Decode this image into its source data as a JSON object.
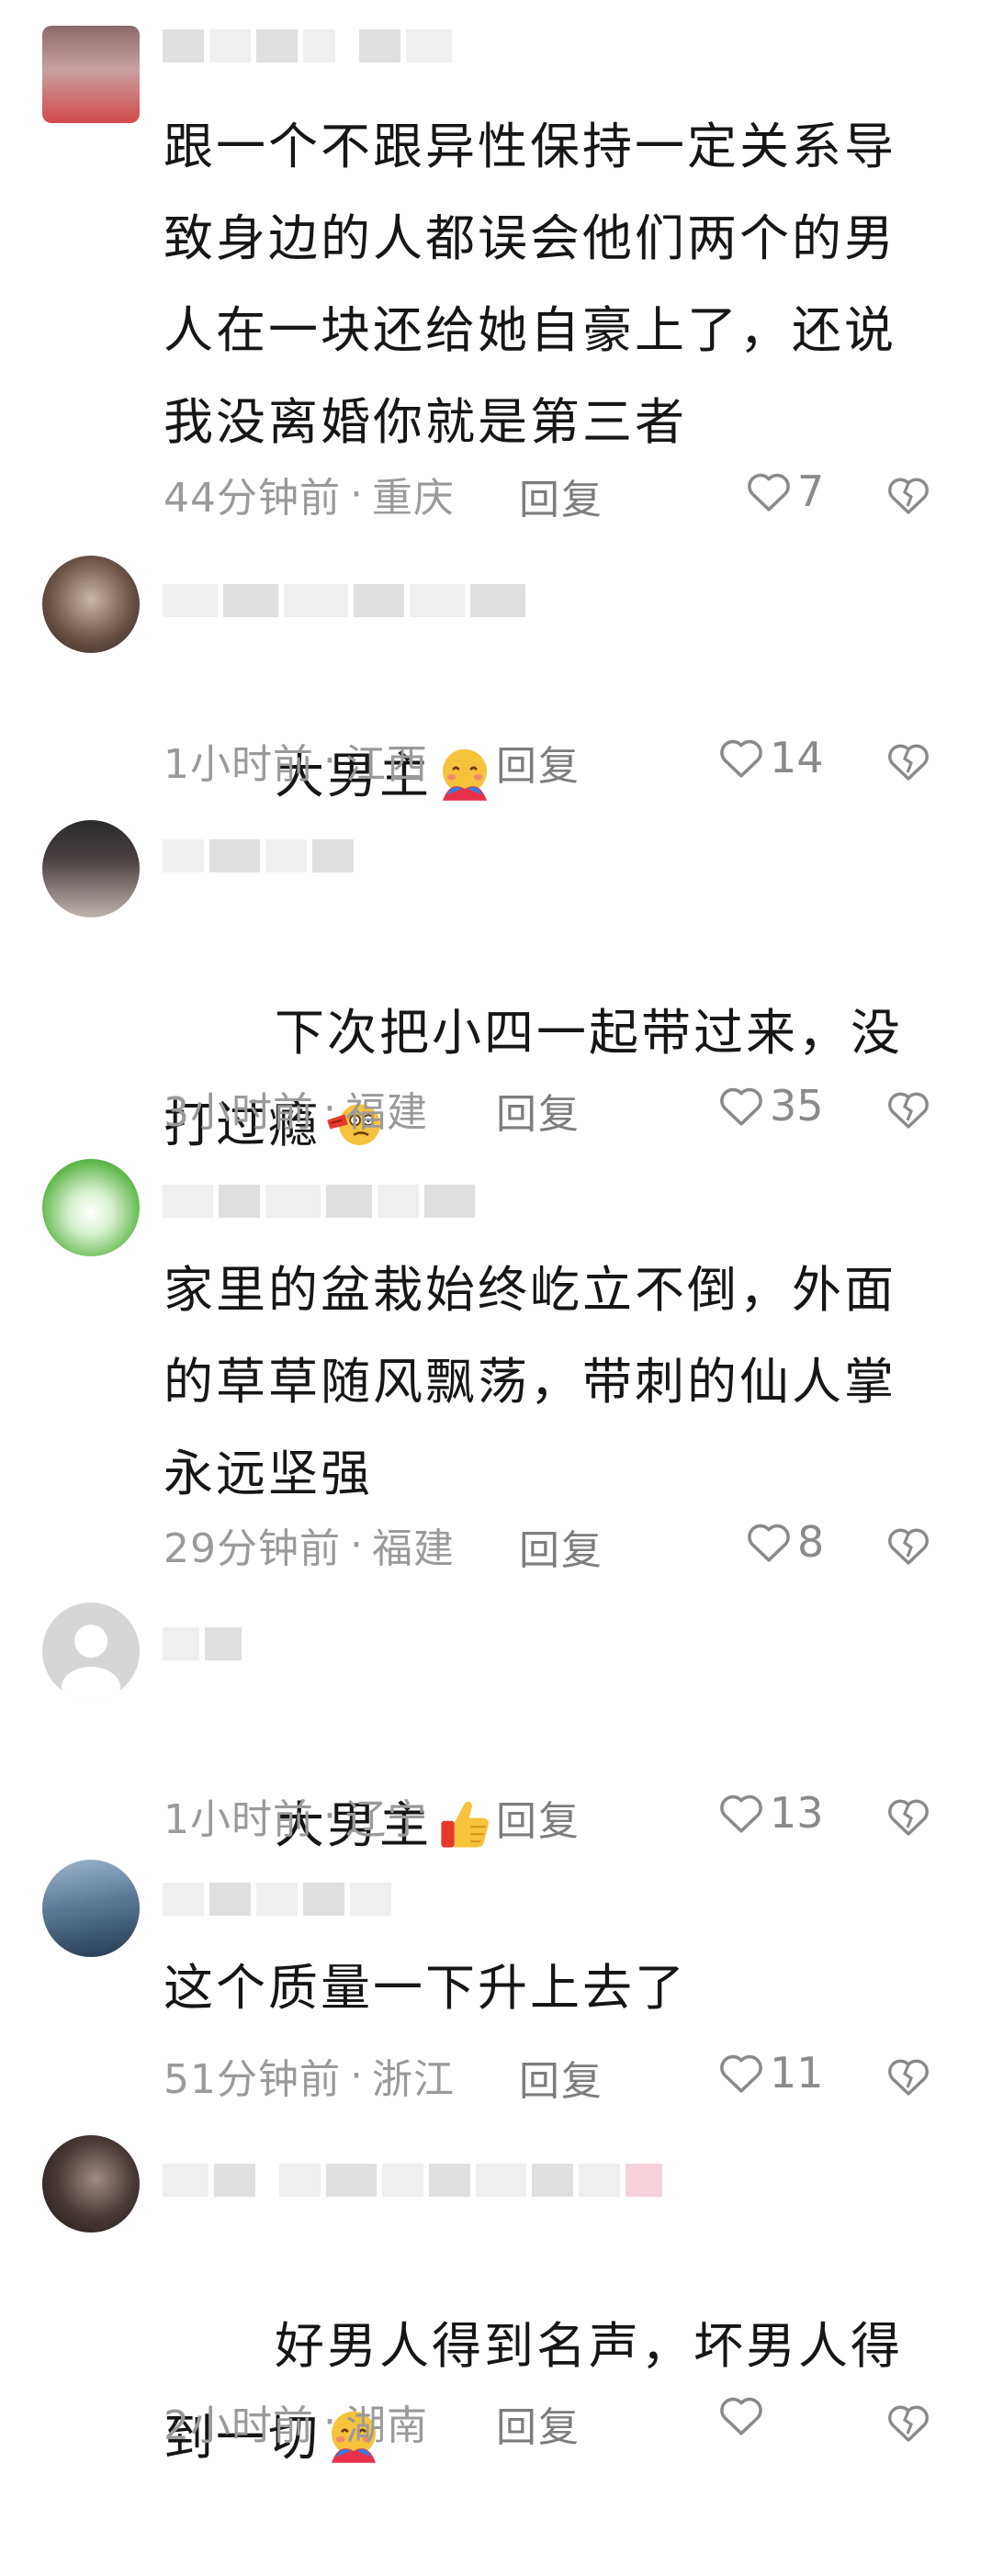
{
  "comments": [
    {
      "text": "跟一个不跟异性保持一定关系导致身边的人都误会他们两个的男人在一块还给她自豪上了，还说我没离婚你就是第三者",
      "time": "44分钟前",
      "location": "重庆",
      "reply_label": "回复",
      "likes": "7",
      "emoji": ""
    },
    {
      "text": "大男主",
      "time": "1小时前",
      "location": "江西",
      "reply_label": "回复",
      "likes": "14",
      "emoji": "hugging-face-emoji"
    },
    {
      "text": "下次把小四一起带过来，没打过瘾",
      "time": "3小时前",
      "location": "福建",
      "reply_label": "回复",
      "likes": "35",
      "emoji": "slap-face-emoji"
    },
    {
      "text": "家里的盆栽始终屹立不倒，外面的草草随风飘荡，带刺的仙人掌永远坚强",
      "time": "29分钟前",
      "location": "福建",
      "reply_label": "回复",
      "likes": "8",
      "emoji": ""
    },
    {
      "text": "大男主",
      "time": "1小时前",
      "location": "辽宁",
      "reply_label": "回复",
      "likes": "13",
      "emoji": "thumbs-up-emoji"
    },
    {
      "text": "这个质量一下升上去了",
      "time": "51分钟前",
      "location": "浙江",
      "reply_label": "回复",
      "likes": "11",
      "emoji": ""
    },
    {
      "text": "好男人得到名声，坏男人得到一切",
      "time": "2小时前",
      "location": "湖南",
      "reply_label": "回复",
      "likes": "",
      "emoji": "hugging-face-emoji"
    }
  ],
  "ui": {
    "meta_separator": "·",
    "like_icon": "heart-outline-icon",
    "dislike_icon": "heart-broken-icon",
    "text_color": "#161616",
    "meta_color": "#9a9a9a"
  }
}
